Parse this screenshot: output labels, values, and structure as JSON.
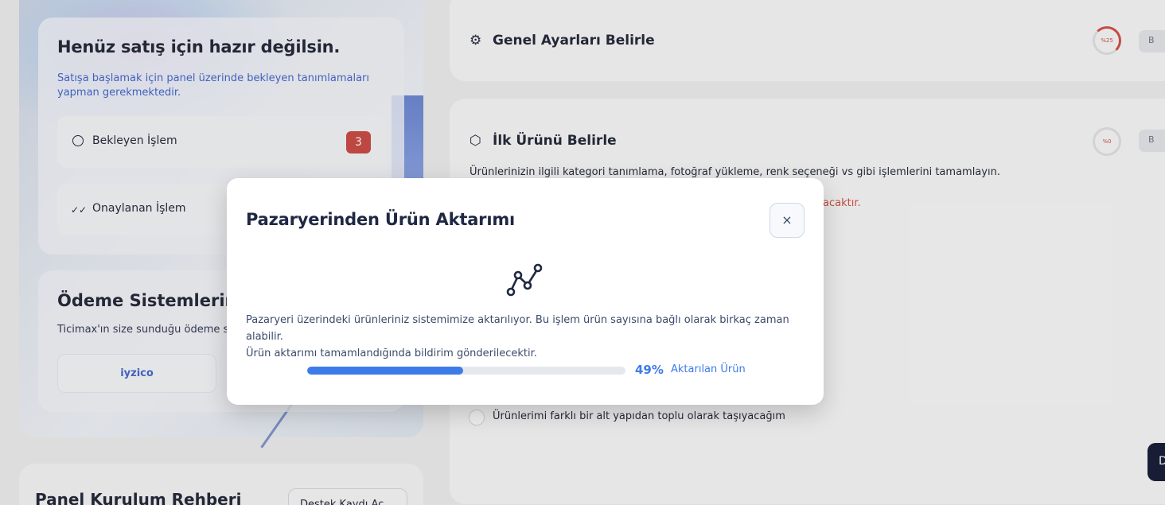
{
  "sidebar": {
    "ready_card": {
      "title": "Henüz satış için hazır değilsin.",
      "subtitle": "Satışa başlamak için panel üzerinde bekleyen tanımlamaları yapman gerekmektedir.",
      "pending_label": "Bekleyen İşlem",
      "pending_count": "3",
      "approved_label": "Onaylanan İşlem"
    },
    "payment_card": {
      "title": "Ödeme Sistemlerimiz",
      "subtitle": "Ticimax'ın size sunduğu ödeme s",
      "provider": "iyzico"
    },
    "guide_card": {
      "title": "Panel Kurulum Rehberi",
      "button": "Destek Kaydı Aç"
    }
  },
  "main": {
    "steps": [
      {
        "title": "Genel Ayarları Belirle",
        "ring": "%25",
        "icon": "gear-icon",
        "pill": "B"
      },
      {
        "title": "İlk Ürünü Belirle",
        "ring": "%0",
        "icon": "box-icon",
        "pill": "B"
      }
    ],
    "step_description": "Ürünlerinizin ilgili kategori tanımlama, fotoğraf yükleme, renk seçeneği vs gibi işlemlerini tamamlayın.",
    "warning_fragment": "acaktır.",
    "option_label": "Ürünlerimi farklı bir alt yapıdan toplu olarak taşıyacağım",
    "side_button": "D"
  },
  "modal": {
    "title": "Pazaryerinden Ürün Aktarımı",
    "close_glyph": "×",
    "description_line1": "Pazaryeri üzerindeki ürünleriniz sistemimize aktarılıyor. Bu işlem ürün sayısına bağlı olarak birkaç zaman alabilir.",
    "description_line2": "Ürün aktarımı tamamlandığında bildirim gönderilecektir.",
    "progress_text": "49%",
    "progress_value": 0.49,
    "progress_label": "Aktarılan Ürün",
    "accent_color": "#3d7be9"
  }
}
